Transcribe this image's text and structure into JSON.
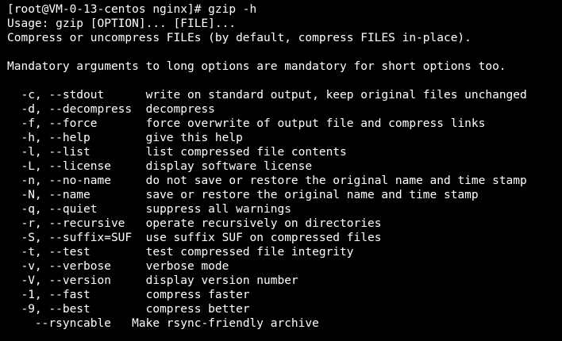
{
  "terminal": {
    "background": "#000000",
    "foreground": "#ffffff",
    "prompt": "[root@VM-0-13-centos nginx]# gzip -h",
    "usage": "Usage: gzip [OPTION]... [FILE]...",
    "summary": "Compress or uncompress FILEs (by default, compress FILES in-place).",
    "mandatory_note": "Mandatory arguments to long options are mandatory for short options too.",
    "options": [
      {
        "flag": "  -c, --stdout      ",
        "desc": "write on standard output, keep original files unchanged"
      },
      {
        "flag": "  -d, --decompress  ",
        "desc": "decompress"
      },
      {
        "flag": "  -f, --force       ",
        "desc": "force overwrite of output file and compress links"
      },
      {
        "flag": "  -h, --help        ",
        "desc": "give this help"
      },
      {
        "flag": "  -l, --list        ",
        "desc": "list compressed file contents"
      },
      {
        "flag": "  -L, --license     ",
        "desc": "display software license"
      },
      {
        "flag": "  -n, --no-name     ",
        "desc": "do not save or restore the original name and time stamp"
      },
      {
        "flag": "  -N, --name        ",
        "desc": "save or restore the original name and time stamp"
      },
      {
        "flag": "  -q, --quiet       ",
        "desc": "suppress all warnings"
      },
      {
        "flag": "  -r, --recursive   ",
        "desc": "operate recursively on directories"
      },
      {
        "flag": "  -S, --suffix=SUF  ",
        "desc": "use suffix SUF on compressed files"
      },
      {
        "flag": "  -t, --test        ",
        "desc": "test compressed file integrity"
      },
      {
        "flag": "  -v, --verbose     ",
        "desc": "verbose mode"
      },
      {
        "flag": "  -V, --version     ",
        "desc": "display version number"
      },
      {
        "flag": "  -1, --fast        ",
        "desc": "compress faster"
      },
      {
        "flag": "  -9, --best        ",
        "desc": "compress better"
      },
      {
        "flag": "    --rsyncable   ",
        "desc": "Make rsync-friendly archive"
      }
    ]
  }
}
